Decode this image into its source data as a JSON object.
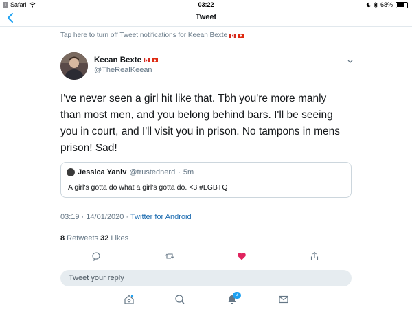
{
  "status_bar": {
    "back_app": "Safari",
    "time": "03:22",
    "battery_percent": "68%",
    "battery_level": 0.68
  },
  "nav": {
    "title": "Tweet"
  },
  "notification_banner": {
    "text": "Tap here to turn off Tweet notifications for Keean Bexte"
  },
  "tweet": {
    "author_name": "Keean Bexte",
    "author_handle": "@TheRealKeean",
    "text": "I've never seen a girl hit like that. Tbh you're more manly than most men, and you belong behind bars. I'll be seeing you in court, and I'll visit you in prison. No tampons in mens prison! Sad!",
    "quote": {
      "name": "Jessica Yaniv",
      "handle": "@trustednerd",
      "time": "5m",
      "text": "A girl's gotta do what a girl's gotta do. <3 #LGBTQ"
    },
    "timestamp": "03:19 · 14/01/2020 · ",
    "source": "Twitter for Android",
    "retweets_count": "8",
    "retweets_label": " Retweets ",
    "likes_count": "32",
    "likes_label": " Likes"
  },
  "reply": {
    "placeholder": "Tweet your reply"
  },
  "tab_bar": {
    "notifications_badge": "2"
  },
  "colors": {
    "accent": "#1da1f2",
    "like": "#e0245e",
    "link": "#1b6bb0",
    "icon": "#657786"
  },
  "icons": [
    "back-chevron-icon",
    "wifi-icon",
    "moon-icon",
    "bluetooth-icon",
    "battery-icon",
    "canada-flag-icon",
    "hong-kong-flag-icon",
    "chevron-down-icon",
    "reply-icon",
    "retweet-icon",
    "like-icon",
    "share-icon",
    "home-icon",
    "search-icon",
    "notifications-icon",
    "messages-icon"
  ]
}
